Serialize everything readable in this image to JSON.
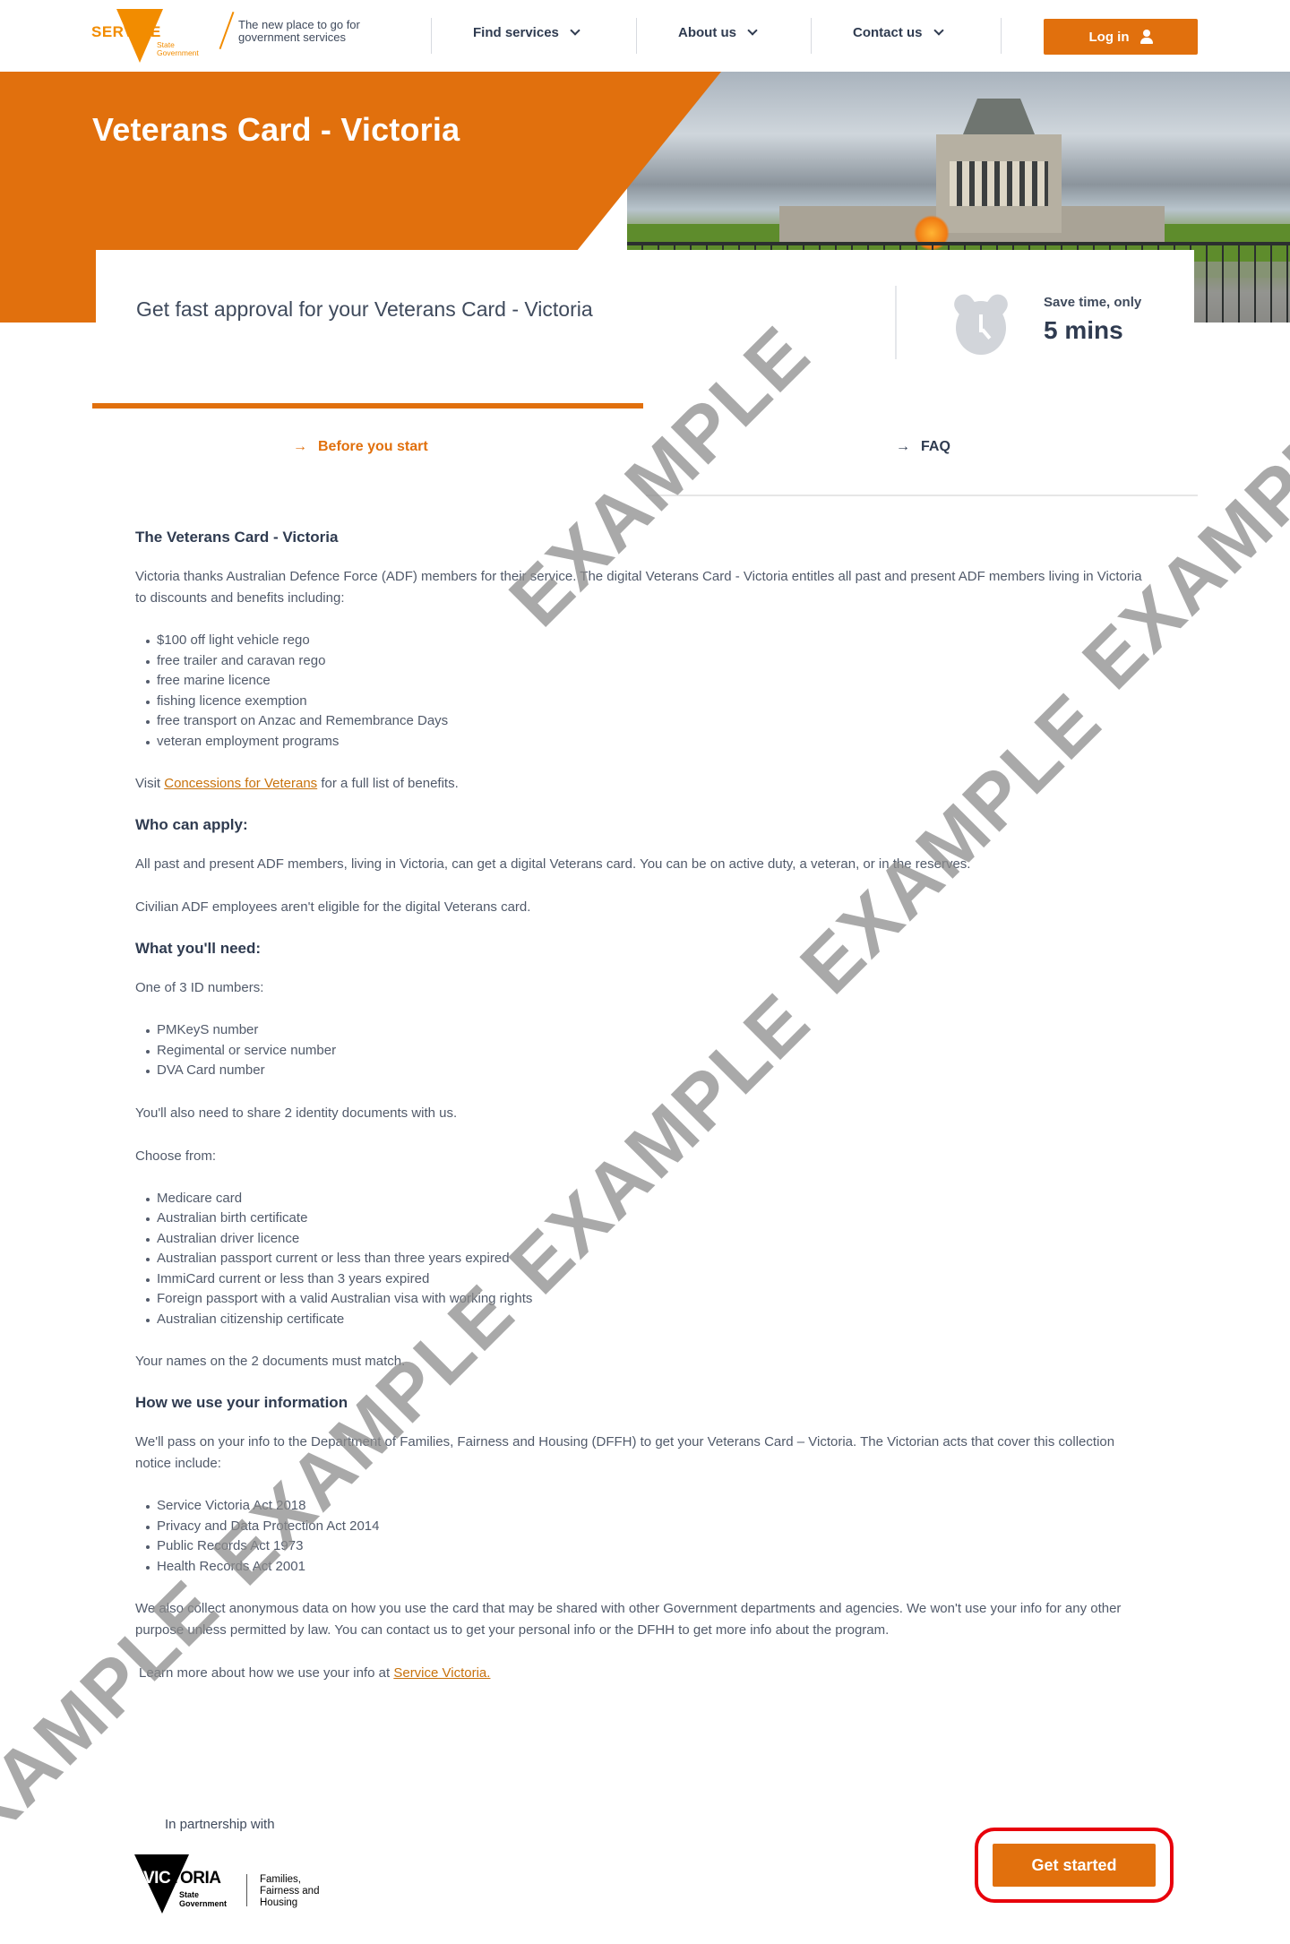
{
  "header": {
    "logo_text": "SERVICE",
    "logo_sub": "State Government",
    "tagline": "The new place to go for government services",
    "nav": [
      {
        "label": "Find services"
      },
      {
        "label": "About us"
      },
      {
        "label": "Contact us"
      }
    ],
    "login_label": "Log in"
  },
  "hero": {
    "title": "Veterans Card - Victoria",
    "image_alt": "Shrine of Remembrance"
  },
  "intro": {
    "text": "Get fast approval for your Veterans Card - Victoria",
    "save_label": "Save time, only",
    "save_value": "5 mins"
  },
  "tabs": [
    {
      "label": "Before you start",
      "active": true
    },
    {
      "label": "FAQ",
      "active": false
    }
  ],
  "content": {
    "s1_heading": "The Veterans Card - Victoria",
    "s1_para": "Victoria thanks Australian Defence Force (ADF) members for their service. The digital Veterans Card - Victoria entitles all past and present ADF members living in Victoria to discounts and benefits including:",
    "benefits": [
      "$100 off light vehicle rego",
      "free trailer and caravan rego",
      "free marine licence",
      "fishing licence exemption",
      "free transport on Anzac and Remembrance Days",
      "veteran employment programs"
    ],
    "visit_prefix": "Visit ",
    "visit_link": "Concessions for Veterans",
    "visit_suffix": " for a full list of benefits.",
    "s2_heading": "Who can apply:",
    "s2_para1": "All past and present ADF members, living in Victoria, can get a digital Veterans card. You can be on active duty, a veteran, or in the reserves.",
    "s2_para2": "Civilian ADF employees aren't eligible for the digital Veterans card.",
    "s3_heading": "What you'll need:",
    "s3_para1": "One of 3 ID numbers:",
    "id_numbers": [
      "PMKeyS number",
      "Regimental or service number",
      "DVA Card number"
    ],
    "s3_para2": "You'll also need to share 2 identity documents with us.",
    "s3_para3": "Choose from:",
    "documents": [
      "Medicare card",
      "Australian birth certificate",
      "Australian driver licence",
      "Australian passport current or less than three years expired",
      "ImmiCard current or less than 3 years expired",
      "Foreign passport with a valid Australian visa with working rights",
      "Australian citizenship certificate"
    ],
    "s3_para4": "Your names on the 2 documents must match.",
    "s4_heading": "How we use your information",
    "s4_para1": "We'll pass on your info to the Department of Families, Fairness and Housing (DFFH) to get your Veterans Card – Victoria. The Victorian acts that cover this collection notice include:",
    "acts": [
      "Service Victoria Act 2018",
      "Privacy and Data Protection Act 2014",
      "Public Records Act 1973",
      "Health Records Act 2001"
    ],
    "s4_para2": "We also collect anonymous data on how you use the card that may be shared with other Government departments and agencies.   We won't use your info for any other purpose unless permitted by law. You can contact us to get your personal info or the DFHH to get more info about the program.",
    "learn_prefix": "Learn more about how we use your info at ",
    "learn_link": "Service Victoria."
  },
  "footer": {
    "partner_label": "In partnership with",
    "vic_word_a": "VIC",
    "vic_word_b": "TORIA",
    "vic_sub": "State Government",
    "dept": "Families, Fairness and Housing",
    "cta_label": "Get started"
  },
  "watermark": {
    "text": "EXAMPLE"
  },
  "colors": {
    "brand_orange": "#e1700d",
    "text_dark": "#2f3b50",
    "link": "#c8720c",
    "highlight": "#e8000b"
  }
}
